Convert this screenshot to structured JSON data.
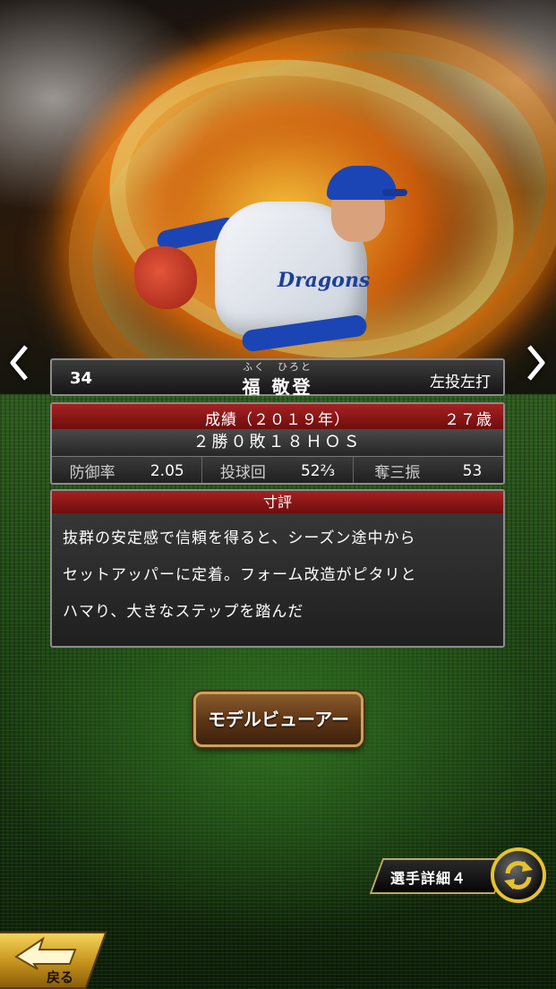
{
  "player": {
    "number": "34",
    "furigana": "ふく　ひろと",
    "name": "福 敬登",
    "handedness": "左投左打",
    "uniform_logo": "Dragons"
  },
  "stats": {
    "season_label": "成績（２０１９年）",
    "age": "２７歳",
    "record": "２勝０敗１８ＨＯＳ",
    "cells": [
      {
        "label": "防御率",
        "value": "2.05"
      },
      {
        "label": "投球回",
        "value": "52⅔"
      },
      {
        "label": "奪三振",
        "value": "53"
      }
    ]
  },
  "comment": {
    "header": "寸評",
    "lines": [
      "抜群の安定感で信頼を得ると、シーズン途中から",
      "セットアッパーに定着。フォーム改造がピタリと",
      "ハマり、大きなステップを踏んだ"
    ]
  },
  "buttons": {
    "model_viewer": "モデルビューアー",
    "player_detail": "選手詳細４",
    "back": "戻る"
  },
  "icons": {
    "prev": "chevron-left-icon",
    "next": "chevron-right-icon",
    "swap": "swap-cycle-icon",
    "back": "back-arrow-icon"
  },
  "colors": {
    "header_red": "#a52222",
    "button_brown": "#5b3415",
    "accent_gold": "#e6c22e",
    "cap_blue": "#1b45b5"
  }
}
